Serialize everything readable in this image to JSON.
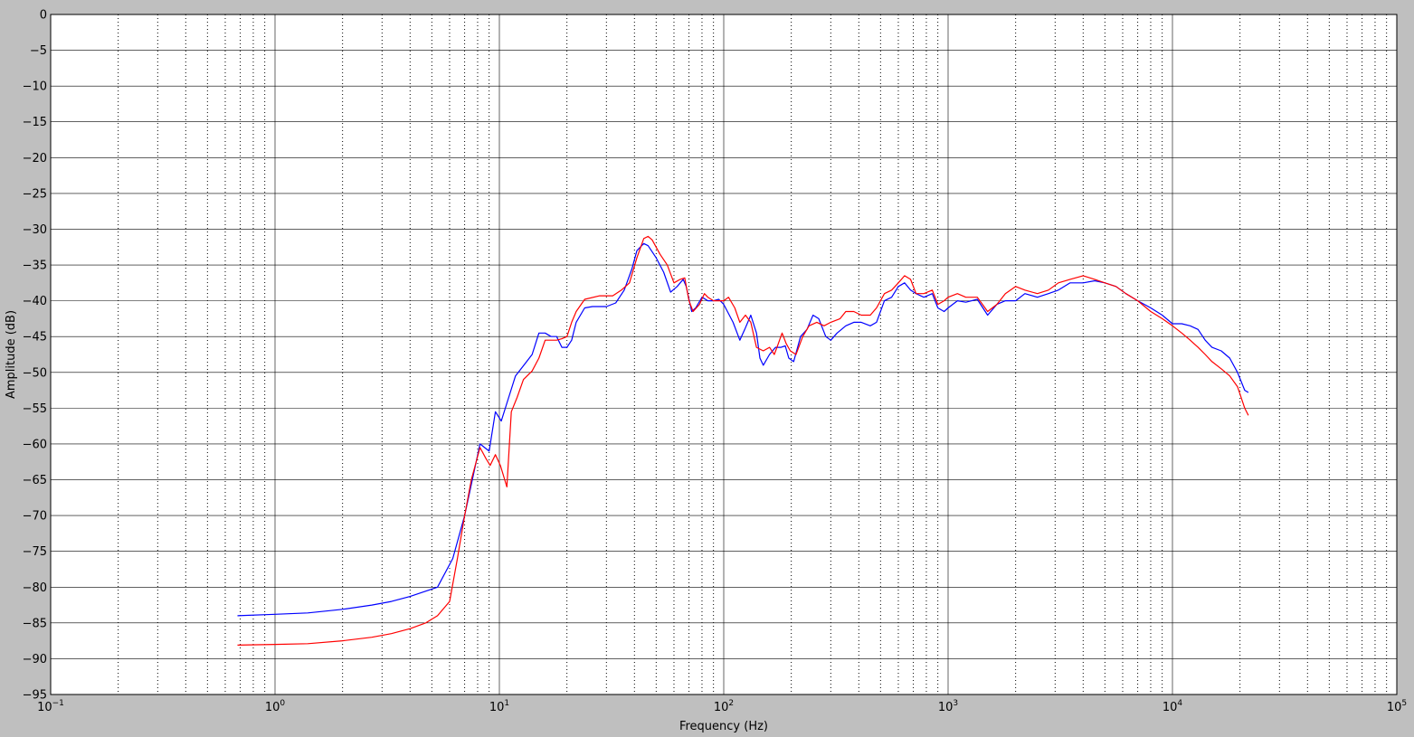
{
  "chart_data": {
    "type": "line",
    "title": "",
    "xlabel": "Frequency (Hz)",
    "ylabel": "Amplitude (dB)",
    "x_scale": "log",
    "xlim": [
      0.1,
      100000
    ],
    "ylim": [
      -95,
      0
    ],
    "y_ticks": [
      "0",
      "−5",
      "−10",
      "−15",
      "−20",
      "−25",
      "−30",
      "−35",
      "−40",
      "−45",
      "−50",
      "−55",
      "−60",
      "−65",
      "−70",
      "−75",
      "−80",
      "−85",
      "−90",
      "−95"
    ],
    "x_ticks": [
      {
        "base": "10",
        "exp": "−1"
      },
      {
        "base": "10",
        "exp": "0"
      },
      {
        "base": "10",
        "exp": "1"
      },
      {
        "base": "10",
        "exp": "2"
      },
      {
        "base": "10",
        "exp": "3"
      },
      {
        "base": "10",
        "exp": "4"
      },
      {
        "base": "10",
        "exp": "5"
      }
    ],
    "grid": {
      "major_solid": true,
      "minor_x_dotted": true
    },
    "legend": "none",
    "series": [
      {
        "color": "#0000ff",
        "points": [
          [
            0.68,
            -84
          ],
          [
            1,
            -83.8
          ],
          [
            1.4,
            -83.6
          ],
          [
            2,
            -83.1
          ],
          [
            2.7,
            -82.5
          ],
          [
            3.3,
            -82
          ],
          [
            4,
            -81.3
          ],
          [
            5.3,
            -80
          ],
          [
            6.2,
            -76
          ],
          [
            7,
            -70
          ],
          [
            7.7,
            -64
          ],
          [
            8.2,
            -60
          ],
          [
            9,
            -61
          ],
          [
            9.6,
            -55.5
          ],
          [
            10.2,
            -56.8
          ],
          [
            11,
            -53.5
          ],
          [
            11.8,
            -50.5
          ],
          [
            13,
            -48.8
          ],
          [
            14,
            -47.5
          ],
          [
            15,
            -44.5
          ],
          [
            16,
            -44.5
          ],
          [
            17,
            -45
          ],
          [
            18,
            -45
          ],
          [
            19,
            -46.5
          ],
          [
            20,
            -46.5
          ],
          [
            21,
            -45.5
          ],
          [
            22,
            -43
          ],
          [
            24,
            -41
          ],
          [
            26,
            -40.8
          ],
          [
            30,
            -40.8
          ],
          [
            33,
            -40.3
          ],
          [
            36,
            -38.5
          ],
          [
            39,
            -35.5
          ],
          [
            41,
            -33
          ],
          [
            44,
            -32
          ],
          [
            46,
            -32.3
          ],
          [
            50,
            -34
          ],
          [
            54,
            -36
          ],
          [
            58,
            -38.8
          ],
          [
            62,
            -38
          ],
          [
            66,
            -37
          ],
          [
            68,
            -38
          ],
          [
            72,
            -41.5
          ],
          [
            75,
            -41
          ],
          [
            80,
            -39.5
          ],
          [
            85,
            -40
          ],
          [
            90,
            -40
          ],
          [
            95,
            -39.8
          ],
          [
            100,
            -40.5
          ],
          [
            110,
            -43
          ],
          [
            118,
            -45.5
          ],
          [
            124,
            -44
          ],
          [
            132,
            -42
          ],
          [
            140,
            -44.5
          ],
          [
            145,
            -48
          ],
          [
            150,
            -49
          ],
          [
            160,
            -47.5
          ],
          [
            170,
            -46.5
          ],
          [
            180,
            -46.5
          ],
          [
            188,
            -46.3
          ],
          [
            195,
            -48
          ],
          [
            205,
            -48.5
          ],
          [
            220,
            -45
          ],
          [
            235,
            -44
          ],
          [
            250,
            -42
          ],
          [
            265,
            -42.5
          ],
          [
            285,
            -45
          ],
          [
            300,
            -45.5
          ],
          [
            320,
            -44.5
          ],
          [
            350,
            -43.5
          ],
          [
            380,
            -43
          ],
          [
            410,
            -43
          ],
          [
            450,
            -43.5
          ],
          [
            480,
            -43
          ],
          [
            520,
            -40
          ],
          [
            560,
            -39.5
          ],
          [
            600,
            -38
          ],
          [
            640,
            -37.5
          ],
          [
            680,
            -38.5
          ],
          [
            720,
            -39
          ],
          [
            780,
            -39.5
          ],
          [
            850,
            -39
          ],
          [
            900,
            -41
          ],
          [
            960,
            -41.5
          ],
          [
            1000,
            -41
          ],
          [
            1100,
            -40
          ],
          [
            1200,
            -40.2
          ],
          [
            1350,
            -39.8
          ],
          [
            1500,
            -42
          ],
          [
            1650,
            -40.5
          ],
          [
            1800,
            -40
          ],
          [
            2000,
            -40
          ],
          [
            2200,
            -39
          ],
          [
            2500,
            -39.5
          ],
          [
            2800,
            -39
          ],
          [
            3100,
            -38.5
          ],
          [
            3500,
            -37.5
          ],
          [
            4000,
            -37.5
          ],
          [
            4500,
            -37.2
          ],
          [
            5000,
            -37.5
          ],
          [
            5600,
            -38
          ],
          [
            6200,
            -39
          ],
          [
            7000,
            -40
          ],
          [
            8000,
            -41
          ],
          [
            9000,
            -42
          ],
          [
            10000,
            -43.2
          ],
          [
            11000,
            -43.2
          ],
          [
            12000,
            -43.5
          ],
          [
            13000,
            -44
          ],
          [
            14000,
            -45.5
          ],
          [
            15000,
            -46.5
          ],
          [
            16500,
            -47
          ],
          [
            18000,
            -48
          ],
          [
            19500,
            -50
          ],
          [
            21000,
            -52.5
          ],
          [
            21800,
            -52.8
          ]
        ]
      },
      {
        "color": "#ff0000",
        "points": [
          [
            0.68,
            -88.1
          ],
          [
            1,
            -88
          ],
          [
            1.4,
            -87.9
          ],
          [
            2,
            -87.5
          ],
          [
            2.7,
            -87
          ],
          [
            3.3,
            -86.5
          ],
          [
            4,
            -85.8
          ],
          [
            4.7,
            -85
          ],
          [
            5.3,
            -84
          ],
          [
            6,
            -82
          ],
          [
            6.5,
            -76
          ],
          [
            7,
            -70
          ],
          [
            7.5,
            -65
          ],
          [
            8.2,
            -60.5
          ],
          [
            8.7,
            -62
          ],
          [
            9.1,
            -63
          ],
          [
            9.6,
            -61.5
          ],
          [
            10.1,
            -63
          ],
          [
            10.8,
            -66
          ],
          [
            11.3,
            -55.5
          ],
          [
            12,
            -53.5
          ],
          [
            12.8,
            -51
          ],
          [
            14,
            -49.8
          ],
          [
            15,
            -48
          ],
          [
            16,
            -45.5
          ],
          [
            17,
            -45.5
          ],
          [
            18,
            -45.5
          ],
          [
            19,
            -45.3
          ],
          [
            20,
            -45
          ],
          [
            21,
            -43
          ],
          [
            22,
            -41.5
          ],
          [
            24,
            -39.8
          ],
          [
            28,
            -39.3
          ],
          [
            32,
            -39.3
          ],
          [
            35,
            -38.5
          ],
          [
            38,
            -37.5
          ],
          [
            41,
            -34
          ],
          [
            44,
            -31.3
          ],
          [
            46,
            -31
          ],
          [
            48,
            -31.5
          ],
          [
            52,
            -33.5
          ],
          [
            56,
            -35
          ],
          [
            60,
            -37.5
          ],
          [
            64,
            -37
          ],
          [
            67,
            -36.8
          ],
          [
            70,
            -40
          ],
          [
            73,
            -41.5
          ],
          [
            78,
            -40.5
          ],
          [
            82,
            -39
          ],
          [
            85,
            -39.5
          ],
          [
            90,
            -40
          ],
          [
            95,
            -40
          ],
          [
            100,
            -40
          ],
          [
            105,
            -39.5
          ],
          [
            112,
            -41
          ],
          [
            118,
            -43
          ],
          [
            125,
            -42
          ],
          [
            132,
            -43
          ],
          [
            140,
            -46.5
          ],
          [
            150,
            -47
          ],
          [
            160,
            -46.5
          ],
          [
            168,
            -47.5
          ],
          [
            175,
            -46
          ],
          [
            182,
            -44.5
          ],
          [
            190,
            -46
          ],
          [
            198,
            -47
          ],
          [
            210,
            -47.5
          ],
          [
            225,
            -45
          ],
          [
            240,
            -43.5
          ],
          [
            260,
            -43
          ],
          [
            280,
            -43.5
          ],
          [
            300,
            -43
          ],
          [
            330,
            -42.5
          ],
          [
            350,
            -41.5
          ],
          [
            380,
            -41.5
          ],
          [
            410,
            -42
          ],
          [
            450,
            -42
          ],
          [
            480,
            -41
          ],
          [
            520,
            -39
          ],
          [
            560,
            -38.5
          ],
          [
            600,
            -37.5
          ],
          [
            640,
            -36.5
          ],
          [
            680,
            -37
          ],
          [
            720,
            -39
          ],
          [
            780,
            -39
          ],
          [
            850,
            -38.5
          ],
          [
            900,
            -40.5
          ],
          [
            960,
            -40
          ],
          [
            1000,
            -39.5
          ],
          [
            1100,
            -39
          ],
          [
            1200,
            -39.5
          ],
          [
            1350,
            -39.5
          ],
          [
            1500,
            -41.5
          ],
          [
            1650,
            -40.5
          ],
          [
            1800,
            -39
          ],
          [
            2000,
            -38
          ],
          [
            2200,
            -38.5
          ],
          [
            2500,
            -39
          ],
          [
            2800,
            -38.5
          ],
          [
            3100,
            -37.5
          ],
          [
            3500,
            -37
          ],
          [
            4000,
            -36.5
          ],
          [
            4500,
            -37
          ],
          [
            5000,
            -37.5
          ],
          [
            5600,
            -38
          ],
          [
            6200,
            -39
          ],
          [
            7000,
            -40
          ],
          [
            8000,
            -41.5
          ],
          [
            9000,
            -42.5
          ],
          [
            10000,
            -43.5
          ],
          [
            11000,
            -44.5
          ],
          [
            12000,
            -45.5
          ],
          [
            13000,
            -46.5
          ],
          [
            14000,
            -47.5
          ],
          [
            15000,
            -48.5
          ],
          [
            16500,
            -49.5
          ],
          [
            18000,
            -50.5
          ],
          [
            19500,
            -52
          ],
          [
            21000,
            -55
          ],
          [
            21800,
            -56
          ]
        ]
      }
    ]
  }
}
